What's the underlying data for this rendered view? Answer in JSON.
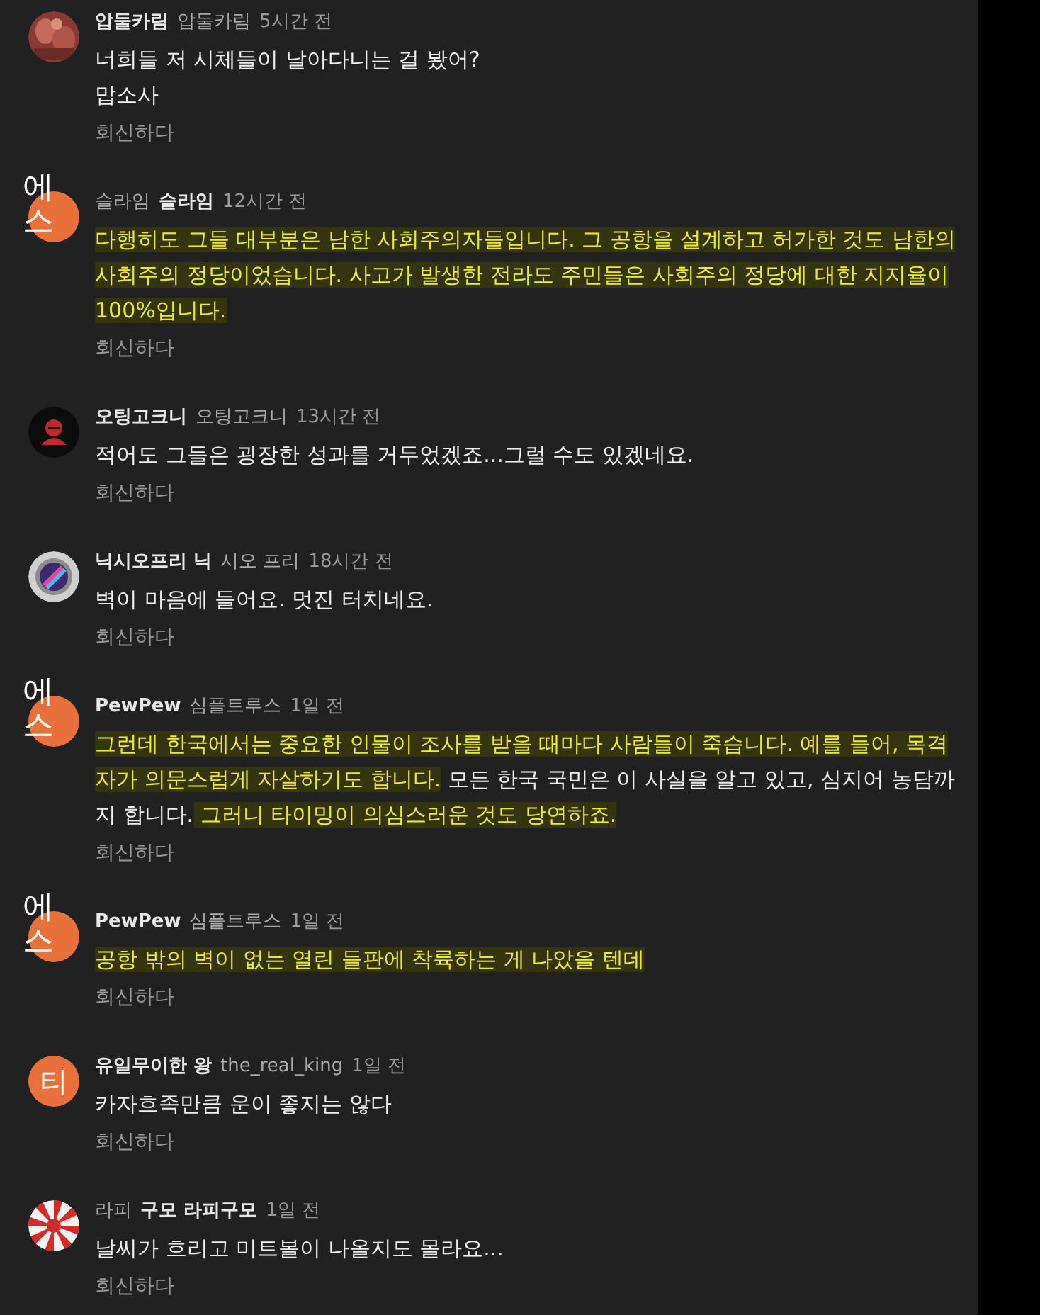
{
  "comments": [
    {
      "avatar": {
        "kind": "picture"
      },
      "header": [
        {
          "text": "압둘카림",
          "bold": true
        },
        {
          "text": "압둘카림",
          "bold": false
        }
      ],
      "time": "5시간 전",
      "body": [
        [
          {
            "text": "너희들 저 시체들이 날아다니는 걸 봤어?",
            "highlighted": false
          }
        ],
        [
          {
            "text": "맙소사",
            "highlighted": false
          }
        ]
      ],
      "reply": "회신하다"
    },
    {
      "avatar": {
        "kind": "broken",
        "alt": "에스"
      },
      "header": [
        {
          "text": "슬라임",
          "bold": false
        },
        {
          "text": "슬라임",
          "bold": true
        }
      ],
      "time": "12시간 전",
      "body": [
        [
          {
            "text": "다행히도 그들 대부분은 남한 사회주의자들입니다. 그 공항을 설계하고 허가한 것도 남한의 사회주의 정당이었습니다. 사고가",
            "highlighted": true
          },
          {
            "text": " 발생한 전라도 주민들은 사회주의 정당에 대한 지지율이 100%입니다.",
            "highlighted": true
          }
        ]
      ],
      "reply": "회신하다"
    },
    {
      "avatar": {
        "kind": "picture"
      },
      "header": [
        {
          "text": "오팅고크니",
          "bold": true
        },
        {
          "text": "오팅고크니",
          "bold": false
        }
      ],
      "time": "13시간 전",
      "body": [
        [
          {
            "text": "적어도 그들은 굉장한 성과를 거두었겠죠...그럴 수도 있겠네요.",
            "highlighted": false
          }
        ]
      ],
      "reply": "회신하다"
    },
    {
      "avatar": {
        "kind": "picture"
      },
      "header": [
        {
          "text": "닉시오프리 닉",
          "bold": true
        },
        {
          "text": "시오 프리",
          "bold": false
        }
      ],
      "time": "18시간 전",
      "body": [
        [
          {
            "text": "벽이 마음에 들어요. 멋진 터치네요.",
            "highlighted": false
          }
        ]
      ],
      "reply": "회신하다"
    },
    {
      "avatar": {
        "kind": "broken",
        "alt": "에스"
      },
      "header": [
        {
          "text": "PewPew",
          "bold": true
        },
        {
          "text": "심플트루스",
          "bold": false
        }
      ],
      "time": "1일 전",
      "body": [
        [
          {
            "text": "그런데 한국에서는 중요한 인물이 조사를 받을 때마다 사람들이 죽습니다. 예를 들어, 목격자가 의문스럽게 자살하기도 합니다.",
            "highlighted": true
          },
          {
            "text": " 모든 한국 국민은 이 사실을 알고 있고, 심지어 농담까지 합니다.",
            "highlighted": false
          },
          {
            "text": " 그러니 타이밍이 의심스러운 것도 당연하죠.",
            "highlighted": true
          }
        ]
      ],
      "reply": "회신하다"
    },
    {
      "avatar": {
        "kind": "broken",
        "alt": "에스"
      },
      "header": [
        {
          "text": "PewPew",
          "bold": true
        },
        {
          "text": "심플트루스",
          "bold": false
        }
      ],
      "time": "1일 전",
      "body": [
        [
          {
            "text": "공항 밖의 벽이 없는 열린 들판에 착륙하는 게 나았을 텐데",
            "highlighted": true
          }
        ]
      ],
      "reply": "회신하다"
    },
    {
      "avatar": {
        "kind": "letter",
        "letter": "티"
      },
      "header": [
        {
          "text": "유일무이한 왕",
          "bold": true
        },
        {
          "text": "the_real_king",
          "bold": false
        }
      ],
      "time": "1일 전",
      "body": [
        [
          {
            "text": "카자흐족만큼 운이 좋지는 않다",
            "highlighted": false
          }
        ]
      ],
      "reply": "회신하다"
    },
    {
      "avatar": {
        "kind": "picture"
      },
      "header": [
        {
          "text": "라피",
          "bold": false
        },
        {
          "text": "구모 라피구모",
          "bold": true
        }
      ],
      "time": "1일 전",
      "body": [
        [
          {
            "text": "날씨가 흐리고 미트볼이 나올지도 몰라요...",
            "highlighted": false
          }
        ]
      ],
      "reply": "회신하다"
    }
  ]
}
